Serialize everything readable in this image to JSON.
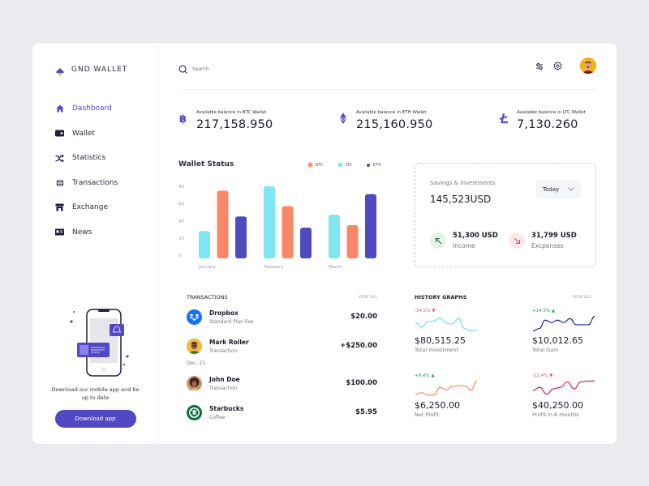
{
  "app": {
    "name": "GND WALLET"
  },
  "sidebar": {
    "items": [
      {
        "label": "Dashboard",
        "icon": "home-icon",
        "active": true
      },
      {
        "label": "Wallet",
        "icon": "wallet-icon",
        "active": false
      },
      {
        "label": "Statistics",
        "icon": "shuffle-icon",
        "active": false
      },
      {
        "label": "Transactions",
        "icon": "globe-icon",
        "active": false
      },
      {
        "label": "Exchange",
        "icon": "store-icon",
        "active": false
      },
      {
        "label": "News",
        "icon": "news-icon",
        "active": false
      }
    ],
    "promo": {
      "text": "Download our mobile app and be up to date",
      "button": "Download app"
    }
  },
  "topbar": {
    "search_placeholder": "Search",
    "icons": [
      "filter-icon",
      "gear-icon",
      "avatar"
    ]
  },
  "balances": [
    {
      "label": "Available balance in BTC Wallet",
      "value": "217,158.950",
      "icon": "bitcoin-icon"
    },
    {
      "label": "Available balance in ETH Wallet",
      "value": "215,160.950",
      "icon": "ethereum-icon"
    },
    {
      "label": "Available balance in LTC Wallet",
      "value": "7,130.260",
      "icon": "litecoin-icon"
    }
  ],
  "colors": {
    "accent": "#5447d6",
    "btc": "#fb8769",
    "ltc": "#7fe6f2",
    "eth": "#4e4bbf",
    "up": "#19a553",
    "down": "#ef4c5a"
  },
  "wallet_status": {
    "title": "Wallet Status",
    "legend": [
      "BTC",
      "LTC",
      "ETH"
    ]
  },
  "chart_data": {
    "type": "bar",
    "title": "Wallet Status",
    "categories": [
      "January",
      "Feburary",
      "March"
    ],
    "series": [
      {
        "name": "LTC",
        "values": [
          28,
          80,
          47
        ]
      },
      {
        "name": "BTC",
        "values": [
          75,
          57,
          35
        ]
      },
      {
        "name": "ETH",
        "values": [
          45,
          32,
          71
        ]
      }
    ],
    "yticks": [
      "80",
      "60",
      "40",
      "20",
      "0"
    ],
    "ylim": [
      0,
      80
    ],
    "xlabel": "",
    "ylabel": "",
    "legend_position": "top-right",
    "grid": false
  },
  "savings": {
    "label": "Savings & Investments",
    "value": "145,523USD",
    "period": "Today",
    "income": {
      "value": "51,300 USD",
      "label": "Income"
    },
    "expenses": {
      "value": "31,799 USD",
      "label": "Excpenses"
    }
  },
  "transactions": {
    "title": "TRANSACTIONS",
    "view_all": "VIEW ALL",
    "items": [
      {
        "name": "Dropbox",
        "sub": "Standard Plan Fee",
        "amount": "$20.00"
      },
      {
        "name": "Mark Roller",
        "sub": "Transaction",
        "amount": "+$250.00"
      }
    ],
    "date_group": "Dec, 21",
    "items2": [
      {
        "name": "John Doe",
        "sub": "Transaction",
        "amount": "$100.00"
      },
      {
        "name": "Starbucks",
        "sub": "Coffee",
        "amount": "$5.95"
      }
    ]
  },
  "history": {
    "title": "HISTORY GRAPHS",
    "view_all": "VIEW ALL",
    "items": [
      {
        "pct": "-14.5%",
        "dir": "down",
        "value": "$80,515.25",
        "label": "Total Investment",
        "color": "#6fdcf0",
        "trend": [
          0.6,
          0.3,
          0.65,
          0.7,
          0.9,
          0.55,
          0.5,
          0.85,
          0.2,
          0.05,
          0.1
        ]
      },
      {
        "pct": "+14.5%",
        "dir": "up",
        "value": "$10,012.65",
        "label": "Total Gain",
        "color": "#1b2a8f",
        "trend": [
          0.05,
          0.2,
          0.75,
          0.6,
          0.75,
          0.6,
          0.85,
          0.45,
          0.45,
          0.45,
          1.0
        ]
      },
      {
        "pct": "+9.4%",
        "dir": "up",
        "value": "$6,250.00",
        "label": "Net Profit",
        "color": "#fb8769",
        "trend": [
          0.15,
          0.25,
          0.1,
          0.1,
          0.6,
          0.45,
          0.65,
          0.7,
          0.7,
          0.4,
          1.0
        ]
      },
      {
        "pct": "-12.4%",
        "dir": "down",
        "value": "$40,250.00",
        "label": "Profit in 6 months",
        "color": "#d01f6b",
        "trend": [
          0.4,
          0.6,
          0.15,
          0.5,
          0.6,
          0.95,
          0.5,
          0.95,
          1.0,
          1.0
        ]
      }
    ]
  }
}
